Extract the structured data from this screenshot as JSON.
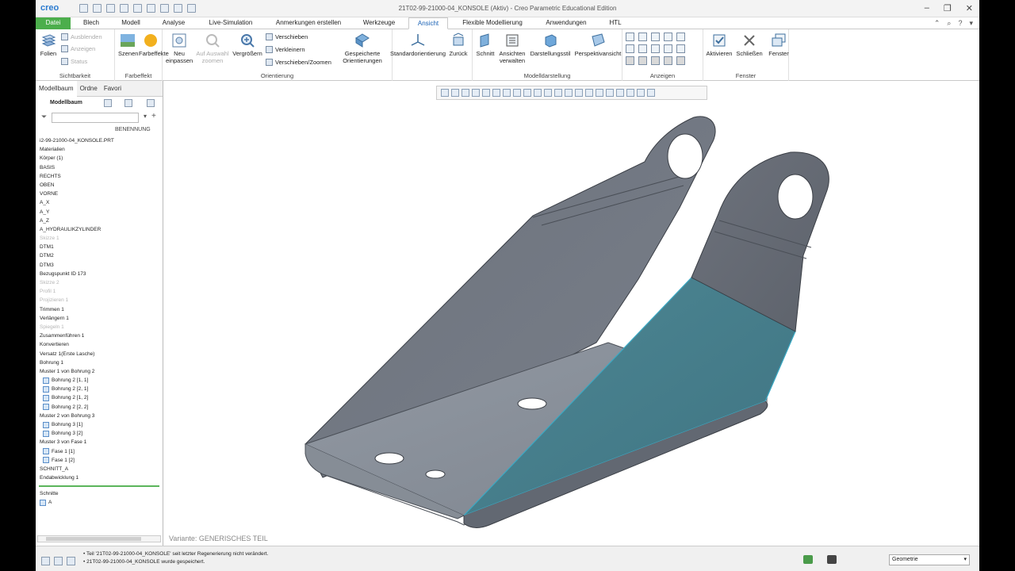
{
  "window": {
    "app_logo": "creo",
    "title": "21T02-99-21000-04_KONSOLE (Aktiv) - Creo Parametric Educational Edition"
  },
  "tabs": [
    "Datei",
    "Blech",
    "Modell",
    "Analyse",
    "Live-Simulation",
    "Anmerkungen erstellen",
    "Werkzeuge",
    "Ansicht",
    "Flexible Modellierung",
    "Anwendungen",
    "HTL"
  ],
  "active_tab": "Ansicht",
  "ribbon": {
    "sichtbarkeit": {
      "label": "Sichtbarkeit",
      "folien": "Folien",
      "ausblenden": "Ausblenden",
      "anzeigen": "Anzeigen",
      "status": "Status"
    },
    "farbeffekt": {
      "label": "Farbeffekt",
      "szenen": "Szenen",
      "farbeffekte": "Farbeffekte"
    },
    "orientierung": {
      "label": "Orientierung",
      "neu_einpassen_1": "Neu",
      "neu_einpassen_2": "einpassen",
      "auf_auswahl_1": "Auf Auswahl",
      "auf_auswahl_2": "zoomen",
      "vergroessern": "Vergrößern",
      "verschieben": "Verschieben",
      "verkleinern": "Verkleinern",
      "verschieben_zoomen": "Verschieben/Zoomen",
      "gespeicherte_1": "Gespeicherte",
      "gespeicherte_2": "Orientierungen",
      "standard": "Standardorientierung",
      "zurueck": "Zurück"
    },
    "modelldarstellung": {
      "label": "Modelldarstellung",
      "schnitt": "Schnitt",
      "ansichten_1": "Ansichten",
      "ansichten_2": "verwalten",
      "darstellungsstil": "Darstellungsstil",
      "perspektiv": "Perspektivansicht"
    },
    "anzeigen": {
      "label": "Anzeigen"
    },
    "fenster": {
      "label": "Fenster",
      "aktivieren": "Aktivieren",
      "schliessen": "Schließen",
      "fenster": "Fenster"
    }
  },
  "panel": {
    "tabs": [
      "Modellbaum",
      "Ordne",
      "Favori"
    ],
    "title": "Modellbaum",
    "column_header": "BENENNUNG",
    "tree": [
      {
        "label": "i2-99-21000-04_KONSOLE.PRT",
        "dim": false
      },
      {
        "label": "Materialien",
        "dim": false
      },
      {
        "label": "Körper (1)",
        "dim": false
      },
      {
        "label": "BASIS",
        "dim": false
      },
      {
        "label": "RECHTS",
        "dim": false
      },
      {
        "label": "OBEN",
        "dim": false
      },
      {
        "label": "VORNE",
        "dim": false
      },
      {
        "label": "A_X",
        "dim": false
      },
      {
        "label": "A_Y",
        "dim": false
      },
      {
        "label": "A_Z",
        "dim": false
      },
      {
        "label": "A_HYDRAULIKZYLINDER",
        "dim": false
      },
      {
        "label": "Skizze 1",
        "dim": true
      },
      {
        "label": "DTM1",
        "dim": false
      },
      {
        "label": "DTM2",
        "dim": false
      },
      {
        "label": "DTM3",
        "dim": false
      },
      {
        "label": "Bezugspunkt ID 173",
        "dim": false
      },
      {
        "label": "Skizze 2",
        "dim": true
      },
      {
        "label": "Profil 1",
        "dim": true
      },
      {
        "label": "Projizieren 1",
        "dim": true
      },
      {
        "label": "Trimmen 1",
        "dim": false
      },
      {
        "label": "Verlängern 1",
        "dim": false
      },
      {
        "label": "Spiegeln 1",
        "dim": true
      },
      {
        "label": "Zusammenführen 1",
        "dim": false
      },
      {
        "label": "Konvertieren",
        "dim": false
      },
      {
        "label": "Versatz 1(Erste Lasche)",
        "dim": false
      },
      {
        "label": "Bohrung 1",
        "dim": false
      },
      {
        "label": "Muster 1 von Bohrung 2",
        "dim": false
      },
      {
        "label": "Bohrung 2 [1, 1]",
        "dim": false,
        "icon": true
      },
      {
        "label": "Bohrung 2 [2, 1]",
        "dim": false,
        "icon": true
      },
      {
        "label": "Bohrung 2 [1, 2]",
        "dim": false,
        "icon": true
      },
      {
        "label": "Bohrung 2 [2, 2]",
        "dim": false,
        "icon": true
      },
      {
        "label": "Muster 2 von Bohrung 3",
        "dim": false
      },
      {
        "label": "Bohrung 3 [1]",
        "dim": false,
        "icon": true
      },
      {
        "label": "Bohrung 3 [2]",
        "dim": false,
        "icon": true
      },
      {
        "label": "Muster 3 von Fase 1",
        "dim": false
      },
      {
        "label": "Fase 1 [1]",
        "dim": false,
        "icon": true
      },
      {
        "label": "Fase 1 [2]",
        "dim": false,
        "icon": true
      },
      {
        "label": "SCHNITT_A",
        "dim": false
      },
      {
        "label": "Endabwicklung 1",
        "dim": false
      }
    ],
    "schnitte_label": "Schnitte",
    "schnitte_item": "A"
  },
  "viewport": {
    "variant": "Variante: GENERISCHES TEIL"
  },
  "status": {
    "msg1": "Teil '21T02-99-21000-04_KONSOLE' seit letzter Regenerierung nicht verändert.",
    "msg2": "21T02-99-21000-04_KONSOLE wurde gespeichert.",
    "filter": "Geometrie"
  },
  "colors": {
    "file_tab": "#4cae4c",
    "active_tab_text": "#1a62b5",
    "part_gray": "#6f7580",
    "highlight": "#4a8190"
  }
}
